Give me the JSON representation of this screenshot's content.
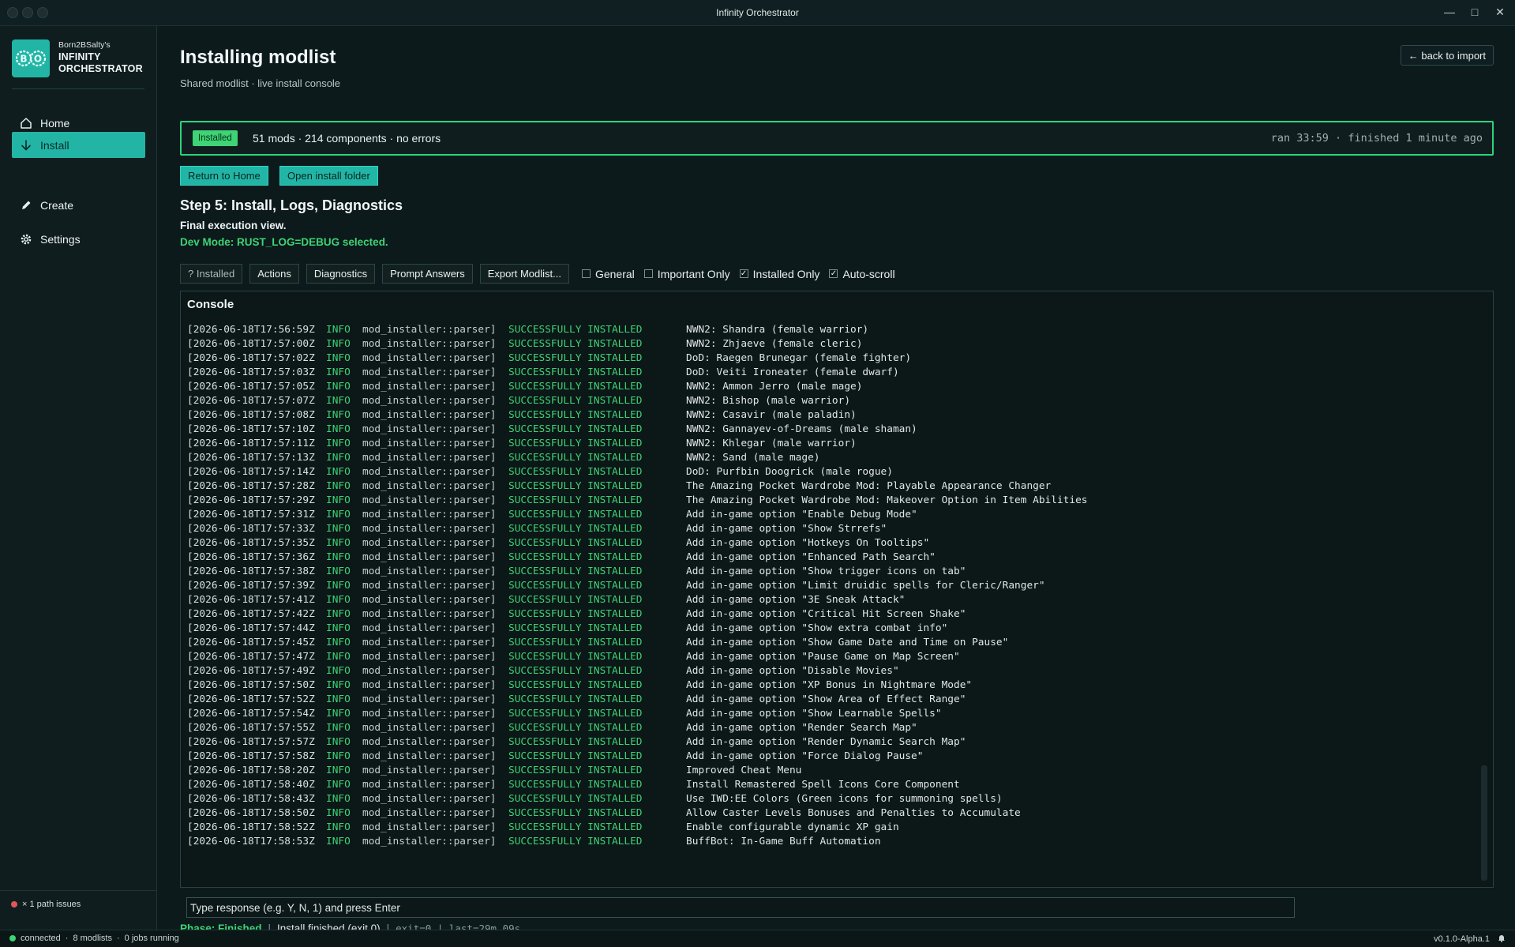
{
  "window": {
    "title": "Infinity Orchestrator"
  },
  "sidebar": {
    "brand_owner": "Born2BSalty's",
    "brand_line1": "INFINITY",
    "brand_line2": "ORCHESTRATOR",
    "logo_text": "B O",
    "nav": [
      {
        "label": "Home",
        "icon": "home-icon"
      },
      {
        "label": "Install",
        "icon": "download-icon",
        "active": true
      },
      {
        "label": "Create",
        "icon": "pencil-icon"
      },
      {
        "label": "Settings",
        "icon": "gear-icon"
      }
    ],
    "path_issues": "× 1 path issues"
  },
  "statusbar": {
    "connected": "connected",
    "modlists": "8 modlists",
    "jobs": "0 jobs running",
    "version": "v0.1.0-Alpha.1"
  },
  "header": {
    "title": "Installing modlist",
    "subtitle": "Shared modlist · live install console",
    "back_label": "← back to import"
  },
  "banner": {
    "badge": "Installed",
    "summary": "51 mods · 214 components · no errors",
    "timing": "ran 33:59 · finished 1 minute ago"
  },
  "actions": {
    "return_home": "Return to Home",
    "open_folder": "Open install folder"
  },
  "step": {
    "title": "Step 5: Install, Logs, Diagnostics",
    "desc": "Final execution view.",
    "dev_mode": "Dev Mode: RUST_LOG=DEBUG selected."
  },
  "toolbar": {
    "installed_btn": "? Installed",
    "actions_btn": "Actions",
    "diagnostics_btn": "Diagnostics",
    "prompt_answers_btn": "Prompt Answers",
    "export_btn": "Export Modlist...",
    "filters": [
      {
        "label": "General",
        "checked": false
      },
      {
        "label": "Important Only",
        "checked": false
      },
      {
        "label": "Installed Only",
        "checked": true
      },
      {
        "label": "Auto-scroll",
        "checked": true
      }
    ]
  },
  "console": {
    "title": "Console",
    "level": "INFO",
    "source": "mod_installer::parser]",
    "status": "SUCCESSFULLY INSTALLED",
    "lines": [
      {
        "ts": "[2026-06-18T17:56:59Z",
        "msg": "NWN2: Shandra (female warrior)"
      },
      {
        "ts": "[2026-06-18T17:57:00Z",
        "msg": "NWN2: Zhjaeve (female cleric)"
      },
      {
        "ts": "[2026-06-18T17:57:02Z",
        "msg": "DoD: Raegen Brunegar (female fighter)"
      },
      {
        "ts": "[2026-06-18T17:57:03Z",
        "msg": "DoD: Veiti Ironeater (female dwarf)"
      },
      {
        "ts": "[2026-06-18T17:57:05Z",
        "msg": "NWN2: Ammon Jerro (male mage)"
      },
      {
        "ts": "[2026-06-18T17:57:07Z",
        "msg": "NWN2: Bishop (male warrior)"
      },
      {
        "ts": "[2026-06-18T17:57:08Z",
        "msg": "NWN2: Casavir (male paladin)"
      },
      {
        "ts": "[2026-06-18T17:57:10Z",
        "msg": "NWN2: Gannayev-of-Dreams (male shaman)"
      },
      {
        "ts": "[2026-06-18T17:57:11Z",
        "msg": "NWN2: Khlegar (male warrior)"
      },
      {
        "ts": "[2026-06-18T17:57:13Z",
        "msg": "NWN2: Sand (male mage)"
      },
      {
        "ts": "[2026-06-18T17:57:14Z",
        "msg": "DoD: Purfbin Doogrick (male rogue)"
      },
      {
        "ts": "[2026-06-18T17:57:28Z",
        "msg": "The Amazing Pocket Wardrobe Mod: Playable Appearance Changer"
      },
      {
        "ts": "[2026-06-18T17:57:29Z",
        "msg": "The Amazing Pocket Wardrobe Mod: Makeover Option in Item Abilities"
      },
      {
        "ts": "[2026-06-18T17:57:31Z",
        "msg": "Add in-game option \"Enable Debug Mode\""
      },
      {
        "ts": "[2026-06-18T17:57:33Z",
        "msg": "Add in-game option \"Show Strrefs\""
      },
      {
        "ts": "[2026-06-18T17:57:35Z",
        "msg": "Add in-game option \"Hotkeys On Tooltips\""
      },
      {
        "ts": "[2026-06-18T17:57:36Z",
        "msg": "Add in-game option \"Enhanced Path Search\""
      },
      {
        "ts": "[2026-06-18T17:57:38Z",
        "msg": "Add in-game option \"Show trigger icons on tab\""
      },
      {
        "ts": "[2026-06-18T17:57:39Z",
        "msg": "Add in-game option \"Limit druidic spells for Cleric/Ranger\""
      },
      {
        "ts": "[2026-06-18T17:57:41Z",
        "msg": "Add in-game option \"3E Sneak Attack\""
      },
      {
        "ts": "[2026-06-18T17:57:42Z",
        "msg": "Add in-game option \"Critical Hit Screen Shake\""
      },
      {
        "ts": "[2026-06-18T17:57:44Z",
        "msg": "Add in-game option \"Show extra combat info\""
      },
      {
        "ts": "[2026-06-18T17:57:45Z",
        "msg": "Add in-game option \"Show Game Date and Time on Pause\""
      },
      {
        "ts": "[2026-06-18T17:57:47Z",
        "msg": "Add in-game option \"Pause Game on Map Screen\""
      },
      {
        "ts": "[2026-06-18T17:57:49Z",
        "msg": "Add in-game option \"Disable Movies\""
      },
      {
        "ts": "[2026-06-18T17:57:50Z",
        "msg": "Add in-game option \"XP Bonus in Nightmare Mode\""
      },
      {
        "ts": "[2026-06-18T17:57:52Z",
        "msg": "Add in-game option \"Show Area of Effect Range\""
      },
      {
        "ts": "[2026-06-18T17:57:54Z",
        "msg": "Add in-game option \"Show Learnable Spells\""
      },
      {
        "ts": "[2026-06-18T17:57:55Z",
        "msg": "Add in-game option \"Render Search Map\""
      },
      {
        "ts": "[2026-06-18T17:57:57Z",
        "msg": "Add in-game option \"Render Dynamic Search Map\""
      },
      {
        "ts": "[2026-06-18T17:57:58Z",
        "msg": "Add in-game option \"Force Dialog Pause\""
      },
      {
        "ts": "[2026-06-18T17:58:20Z",
        "msg": "Improved Cheat Menu"
      },
      {
        "ts": "[2026-06-18T17:58:40Z",
        "msg": "Install Remastered Spell Icons Core Component"
      },
      {
        "ts": "[2026-06-18T17:58:43Z",
        "msg": "Use IWD:EE Colors (Green icons for summoning spells)"
      },
      {
        "ts": "[2026-06-18T17:58:50Z",
        "msg": "Allow Caster Levels Bonuses and Penalties to Accumulate"
      },
      {
        "ts": "[2026-06-18T17:58:52Z",
        "msg": "Enable configurable dynamic XP gain"
      },
      {
        "ts": "[2026-06-18T17:58:53Z",
        "msg": "BuffBot: In-Game Buff Automation"
      }
    ]
  },
  "input": {
    "placeholder": "Type response (e.g. Y, N, 1) and press Enter"
  },
  "phase": {
    "label": "Phase: Finished",
    "sep": "|",
    "message": "Install finished (exit 0)",
    "details": "exit=0 | last=29m 09s"
  },
  "colors": {
    "accent": "#22b5a5",
    "success": "#3ed374",
    "background": "#0d1a1c"
  }
}
